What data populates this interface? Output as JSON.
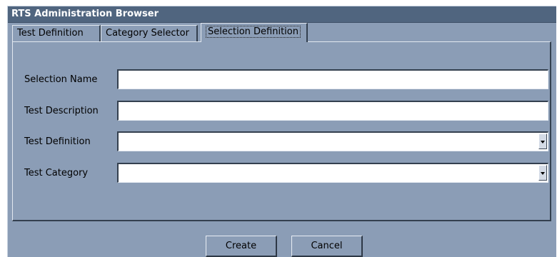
{
  "window": {
    "title": "RTS Administration Browser"
  },
  "tabs": [
    {
      "label": "Test Definition"
    },
    {
      "label": "Category Selector"
    },
    {
      "label": "Selection Definition",
      "selected": true
    }
  ],
  "form": {
    "selection_name": {
      "label": "Selection Name",
      "value": ""
    },
    "test_description": {
      "label": "Test Description",
      "value": ""
    },
    "test_definition": {
      "label": "Test Definition",
      "value": ""
    },
    "test_category": {
      "label": "Test Category",
      "value": ""
    }
  },
  "buttons": {
    "create": "Create",
    "cancel": "Cancel"
  },
  "colors": {
    "window_bg": "#8b9db6",
    "titlebar_bg": "#50657f"
  }
}
